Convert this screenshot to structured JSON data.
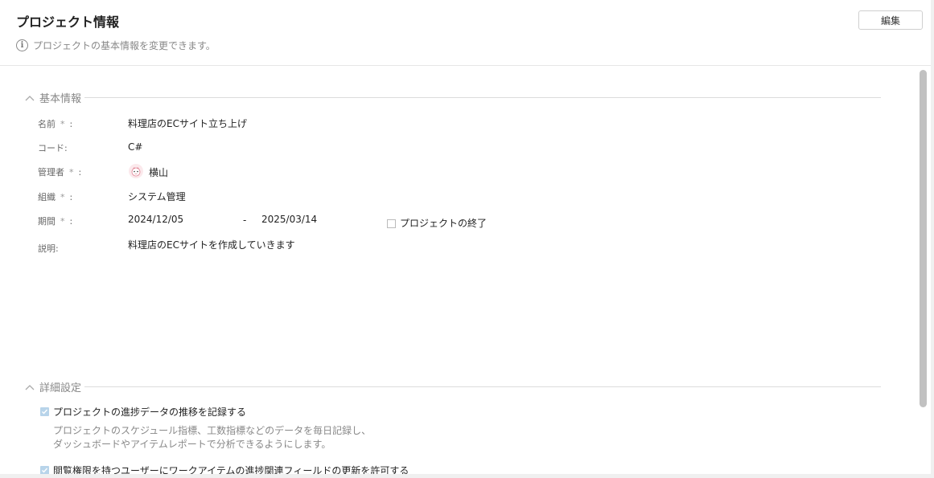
{
  "header": {
    "title": "プロジェクト情報",
    "subtitle": "プロジェクトの基本情報を変更できます。",
    "edit_label": "編集"
  },
  "basic": {
    "section_title": "基本情報",
    "required_mark": "*",
    "fields": {
      "name": {
        "label": "名前",
        "colon": ":",
        "value": "料理店のECサイト立ち上げ"
      },
      "code": {
        "label": "コード:",
        "value": "C#"
      },
      "manager": {
        "label": "管理者",
        "colon": ":",
        "value": "横山",
        "avatar_icon": "mascot-avatar-icon"
      },
      "org": {
        "label": "組織",
        "colon": ":",
        "value": "システム管理"
      },
      "period": {
        "label": "期間",
        "colon": ":",
        "start": "2024/12/05",
        "separator": "-",
        "end": "2025/03/14",
        "finish_label": "プロジェクトの終了",
        "finish_checked": false
      },
      "desc": {
        "label": "説明:",
        "value": "料理店のECサイトを作成していきます"
      }
    }
  },
  "advanced": {
    "section_title": "詳細設定",
    "options": [
      {
        "label": "プロジェクトの進捗データの推移を記録する",
        "checked": true,
        "desc_line1": "プロジェクトのスケジュール指標、工数指標などのデータを毎日記録し、",
        "desc_line2": "ダッシュボードやアイテムレポートで分析できるようにします。"
      },
      {
        "label": "閲覧権限を持つユーザーにワークアイテムの進捗関連フィールドの更新を許可する",
        "checked": true
      }
    ]
  },
  "colors": {
    "accent_checkbox": "#b8d4ea",
    "divider": "#dcdcdc",
    "muted_text": "#888888"
  }
}
